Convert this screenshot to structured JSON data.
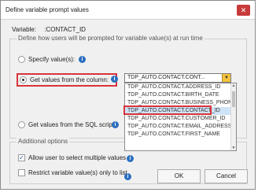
{
  "window": {
    "title": "Define variable prompt values",
    "close_glyph": "✕"
  },
  "variable": {
    "label": "Variable:",
    "name": ":CONTACT_ID"
  },
  "prompt_group": {
    "legend": "Define how users will be prompted for variable value(s) at run time",
    "options": {
      "specify": "Specify value(s):",
      "from_column": "Get values from the column:",
      "from_sql": "Get values from the SQL script:"
    },
    "selected_option": "from_column"
  },
  "column_dropdown": {
    "value": "TDP_AUTO.CONTACT.CONT...",
    "arrow": "▼",
    "items": [
      "TDP_AUTO.CONTACT.ADDRESS_ID",
      "TDP_AUTO.CONTACT.BIRTH_DATE",
      "TDP_AUTO.CONTACT.BUSINESS_PHONE",
      "TDP_AUTO.CONTACT.CONTACT_ID",
      "TDP_AUTO.CONTACT.CUSTOMER_ID",
      "TDP_AUTO.CONTACT.EMAIL_ADDRESS",
      "TDP_AUTO.CONTACT.FIRST_NAME"
    ],
    "selected_item": "TDP_AUTO.CONTACT.CONTACT_ID"
  },
  "additional_group": {
    "legend": "Additional options",
    "allow_multiple": "Allow user to select multiple values",
    "allow_multiple_checked": true,
    "restrict_to_list": "Restrict variable value(s) only to list",
    "restrict_checked": false
  },
  "buttons": {
    "ok": "OK",
    "cancel": "Cancel"
  },
  "icons": {
    "info": "i",
    "check": "✓",
    "scroll_up": "▲",
    "scroll_down": "▼"
  },
  "colors": {
    "highlight": "#d9343a",
    "info": "#2b6fbf",
    "close": "#c63a3a",
    "dropdown_arrow": "#f5c33b"
  }
}
